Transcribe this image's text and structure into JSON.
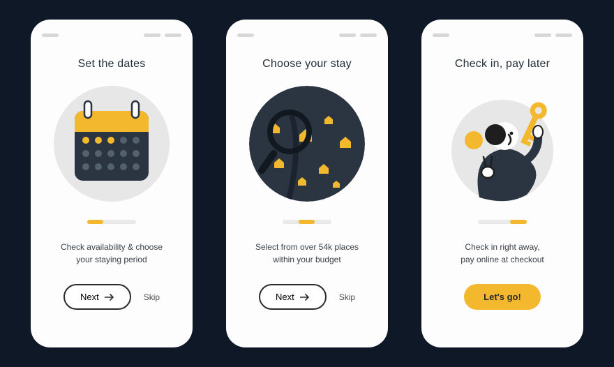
{
  "screens": [
    {
      "title": "Set the dates",
      "description": "Check availability & choose\nyour staying period",
      "progress": {
        "offset_pct": 0,
        "width_pct": 33
      },
      "next_label": "Next",
      "skip_label": "Skip",
      "has_skip": true,
      "button_style": "outline"
    },
    {
      "title": "Choose your stay",
      "description": "Select from over 54k places\nwithin your budget",
      "progress": {
        "offset_pct": 33,
        "width_pct": 33
      },
      "next_label": "Next",
      "skip_label": "Skip",
      "has_skip": true,
      "button_style": "outline"
    },
    {
      "title": "Check in, pay later",
      "description": "Check in right away,\npay online at checkout",
      "progress": {
        "offset_pct": 66,
        "width_pct": 34
      },
      "next_label": "Let's go!",
      "has_skip": false,
      "button_style": "solid"
    }
  ],
  "colors": {
    "accent": "#f4b82e",
    "dark": "#2b3441",
    "bg": "#0e1826"
  }
}
